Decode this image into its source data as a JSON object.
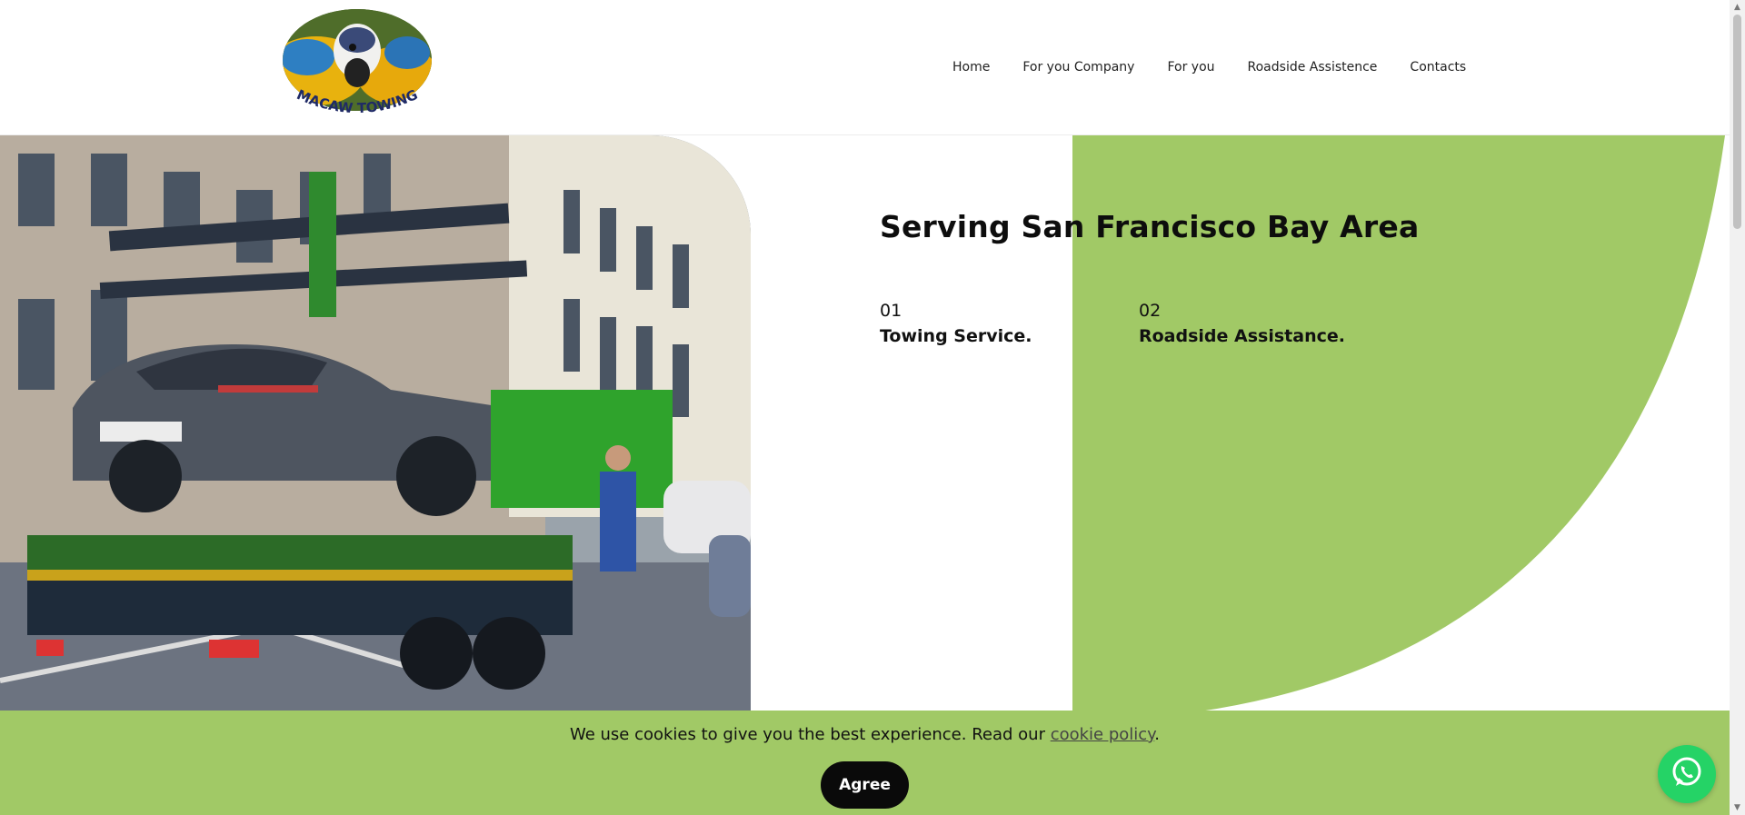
{
  "brand": {
    "logo_text": "MACAW TOWING"
  },
  "nav": {
    "items": [
      {
        "label": "Home"
      },
      {
        "label": "For you Company"
      },
      {
        "label": "For you"
      },
      {
        "label": "Roadside Assistence"
      },
      {
        "label": "Contacts"
      }
    ]
  },
  "hero": {
    "heading": "Serving San Francisco Bay Area",
    "features": [
      {
        "number": "01",
        "title": "Towing Service."
      },
      {
        "number": "02",
        "title": "Roadside Assistance."
      }
    ]
  },
  "cookie": {
    "text_before": "We use cookies to give you the best experience. Read our ",
    "link_label": "cookie policy",
    "text_after": ".",
    "agree_label": "Agree"
  },
  "colors": {
    "accent_green": "#a1c966",
    "whatsapp_green": "#25d366",
    "button_black": "#0a0a0a"
  }
}
